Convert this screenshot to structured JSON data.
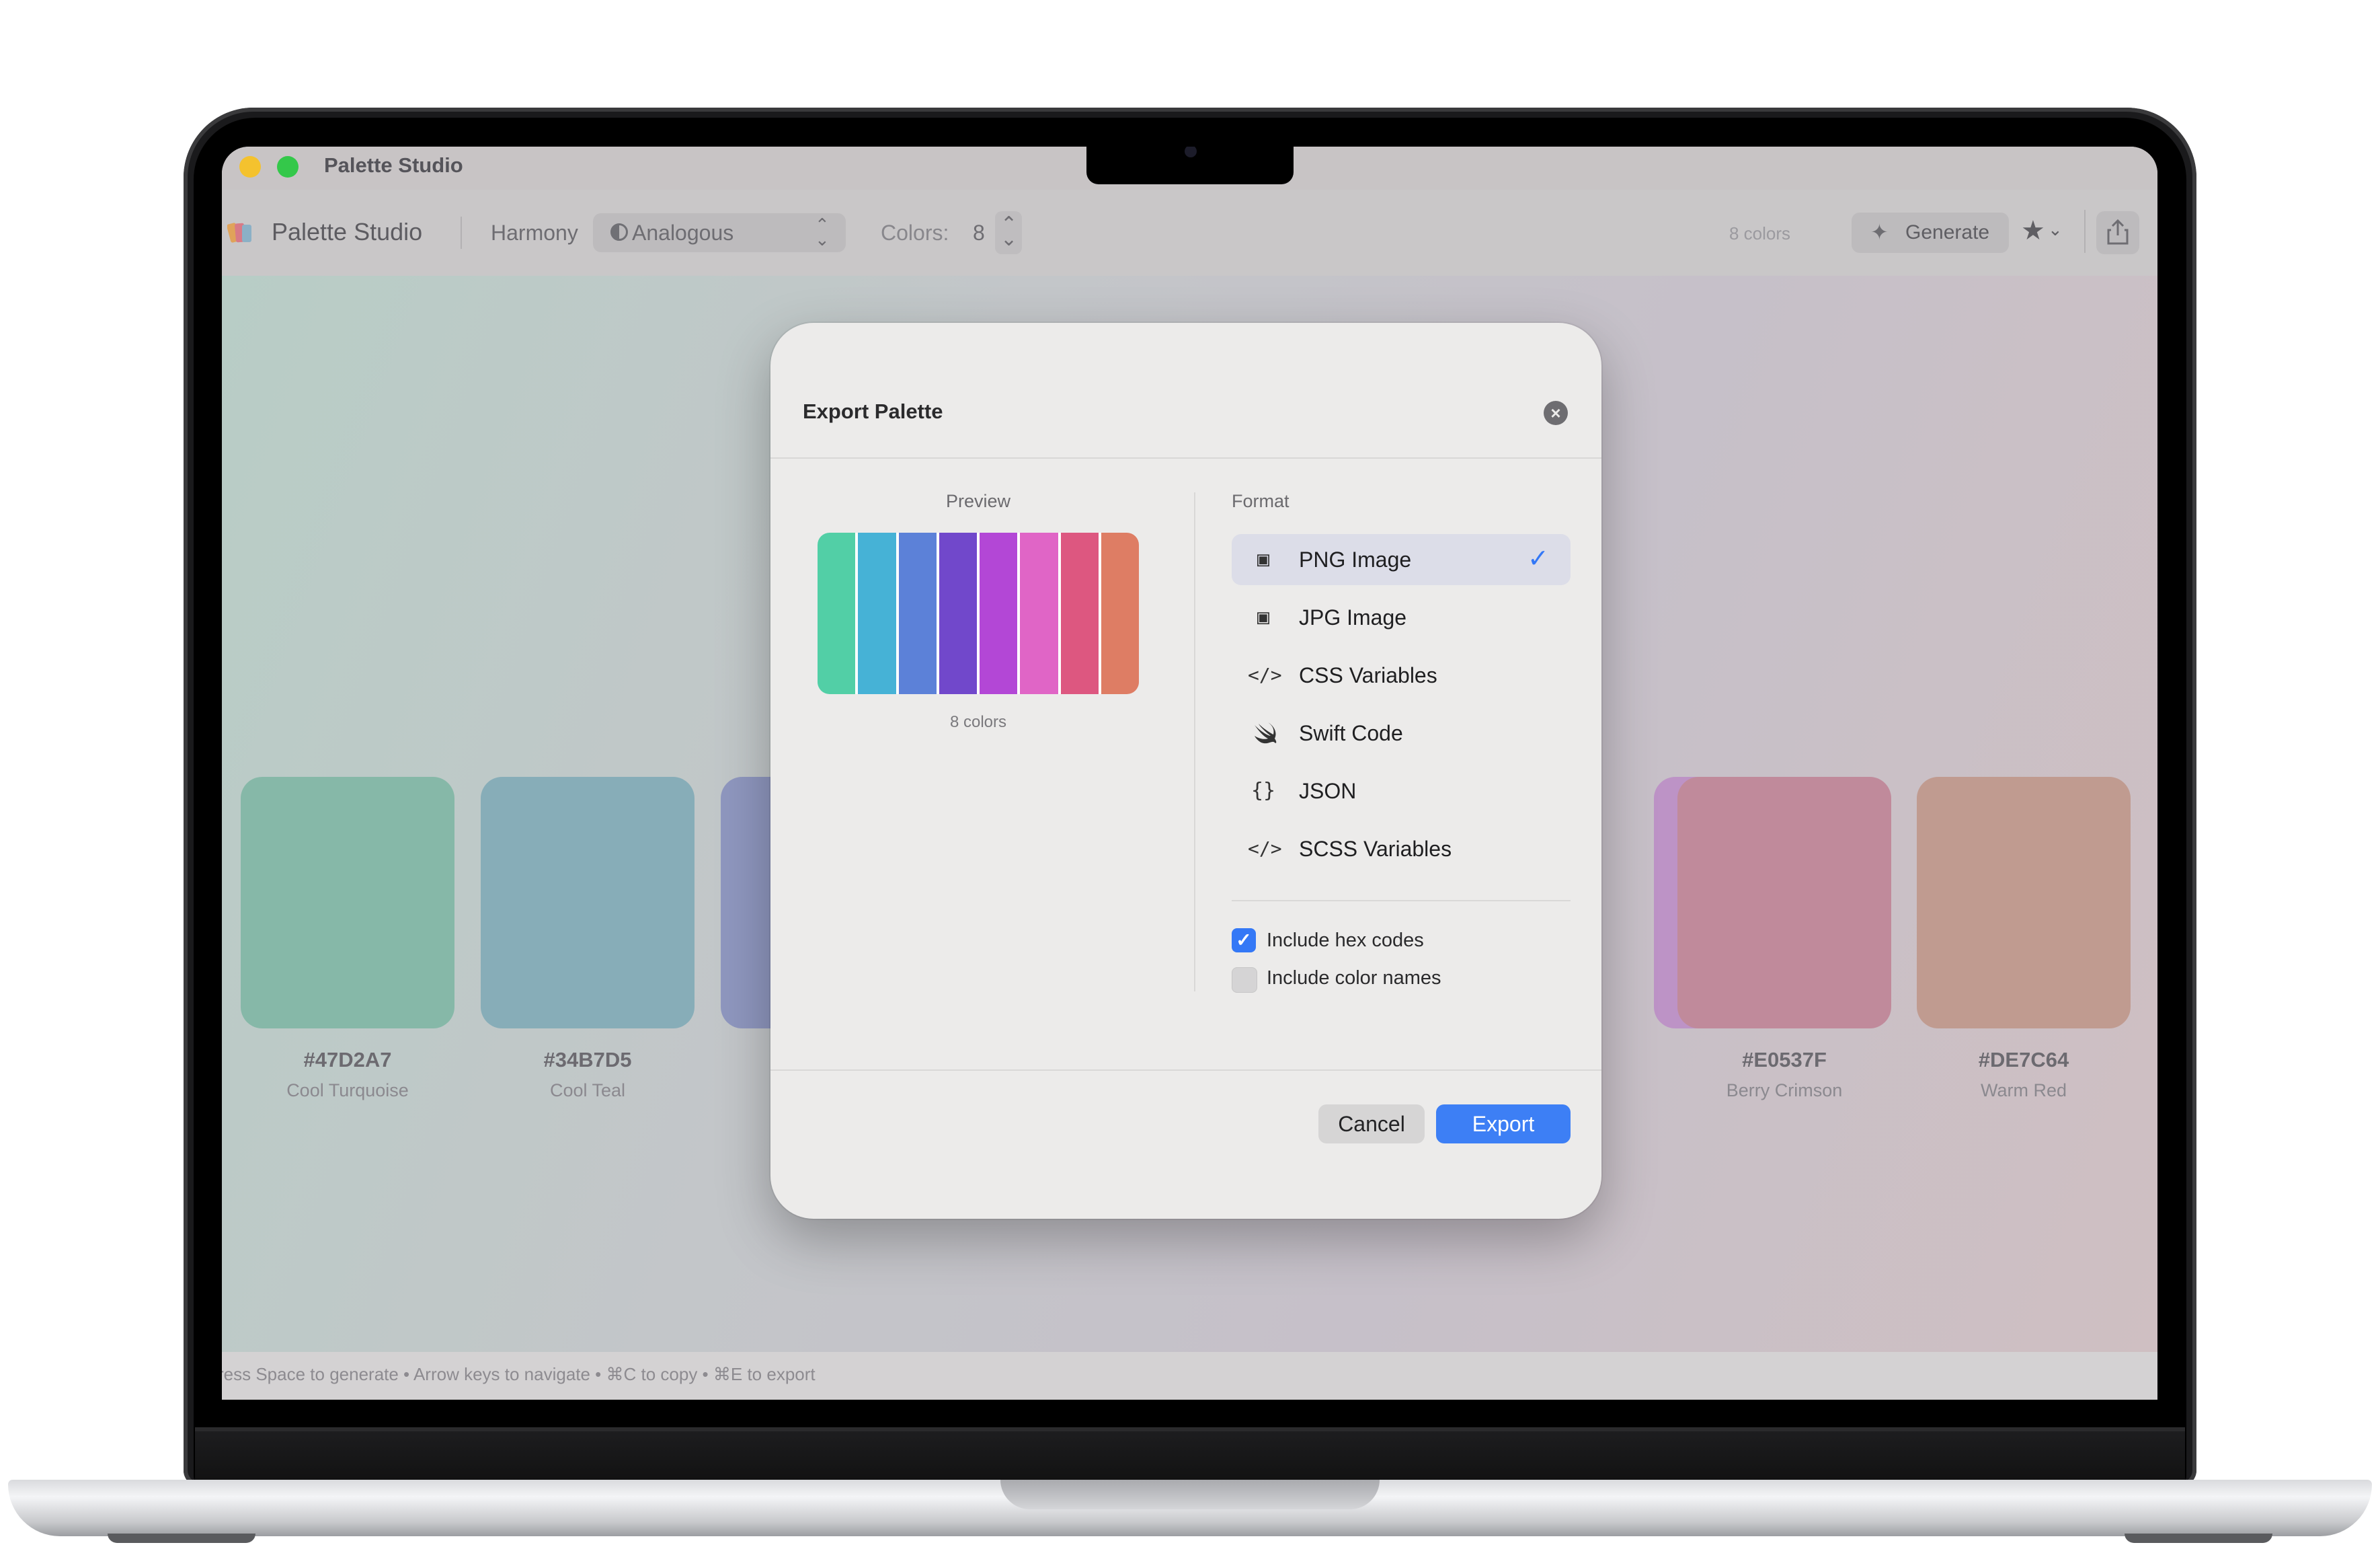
{
  "window": {
    "title": "Palette Studio"
  },
  "toolbar": {
    "app_name": "Palette Studio",
    "harmony_label": "Harmony",
    "harmony_value": "Analogous",
    "colors_label": "Colors:",
    "colors_value": "8",
    "count_text": "8 colors",
    "generate_label": "Generate",
    "icons": {
      "app": "palette-icon",
      "harmony": "half-circle-icon",
      "generate": "sparkle-icon",
      "favorite": "star-icon",
      "share": "share-icon"
    }
  },
  "palette": [
    {
      "hex": "#47D2A7",
      "name": "Cool Turquoise",
      "display": "#86b8a8"
    },
    {
      "hex": "#34B7D5",
      "name": "Cool Teal",
      "display": "#87adb8"
    },
    {
      "hex": "",
      "name": "",
      "display": "#8f97bf"
    },
    {
      "hex": "",
      "name": "",
      "display": "#bd93c6"
    },
    {
      "hex": "#E0537F",
      "name": "Berry Crimson",
      "display": "#c08a9b"
    },
    {
      "hex": "#DE7C64",
      "name": "Warm Red",
      "display": "#c09b90"
    }
  ],
  "status_bar": {
    "text": "ress Space to generate • Arrow keys to navigate • ⌘C to copy • ⌘E to export"
  },
  "dialog": {
    "title": "Export Palette",
    "preview_label": "Preview",
    "preview_colors": [
      "#52cfa6",
      "#46b2d6",
      "#5c81d8",
      "#7148cb",
      "#b347d6",
      "#e065c6",
      "#dd5780",
      "#de7d64"
    ],
    "preview_count": "8 colors",
    "format_label": "Format",
    "formats": [
      {
        "label": "PNG Image",
        "icon": "image-icon",
        "selected": true
      },
      {
        "label": "JPG Image",
        "icon": "image-icon",
        "selected": false
      },
      {
        "label": "CSS Variables",
        "icon": "code-icon",
        "selected": false
      },
      {
        "label": "Swift Code",
        "icon": "swift-icon",
        "selected": false
      },
      {
        "label": "JSON",
        "icon": "braces-icon",
        "selected": false
      },
      {
        "label": "SCSS Variables",
        "icon": "code-icon",
        "selected": false
      }
    ],
    "include_hex": {
      "label": "Include hex codes",
      "checked": true
    },
    "include_names": {
      "label": "Include color names",
      "checked": false
    },
    "cancel_label": "Cancel",
    "export_label": "Export"
  },
  "colors": {
    "accent": "#3478f6",
    "close": "#f4c22e",
    "maximize": "#34c84a"
  }
}
